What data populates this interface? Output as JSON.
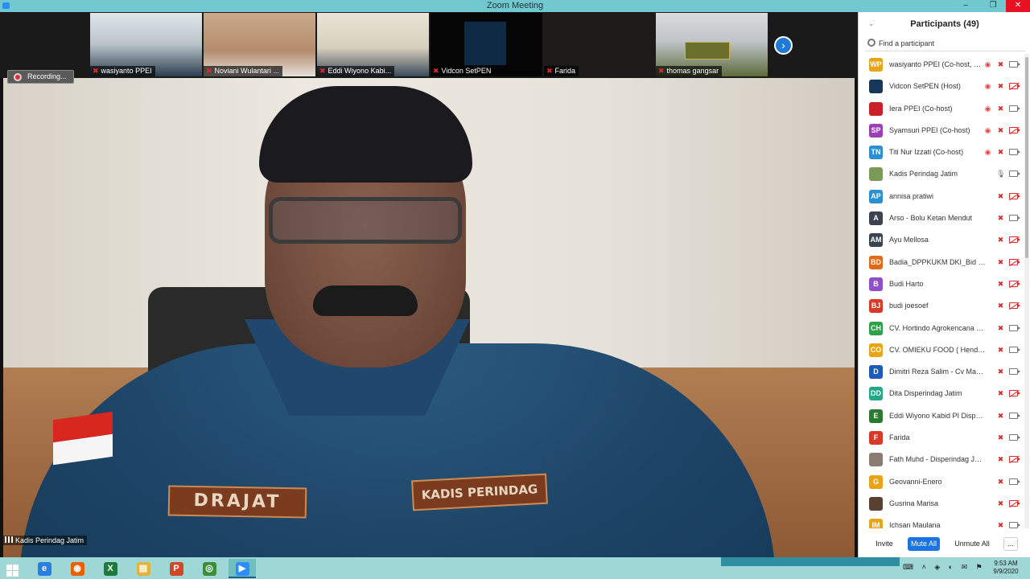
{
  "window": {
    "title": "Zoom Meeting",
    "minimize_glyph": "–",
    "maximize_glyph": "❐",
    "close_glyph": "✕"
  },
  "gallery": {
    "thumbnails": [
      {
        "name": "wasiyanto PPEI",
        "muted": true
      },
      {
        "name": "Noviani Wulantari ...",
        "muted": true
      },
      {
        "name": "Eddi Wiyono Kabi...",
        "muted": true
      },
      {
        "name": "Vidcon SetPEN",
        "muted": true
      },
      {
        "name": "Farida",
        "muted": true
      },
      {
        "name": "thomas gangsar",
        "muted": true
      }
    ],
    "next_glyph": "›"
  },
  "recording": {
    "label": "Recording..."
  },
  "active_speaker": {
    "label": "Kadis Perindag Jatim",
    "name_tag": "DRAJAT",
    "role_tag": "KADIS PERINDAG"
  },
  "participants_panel": {
    "title": "Participants (49)",
    "search_placeholder": "Find a participant",
    "participants": [
      {
        "initials": "WP",
        "name": "wasiyanto PPEI (Co-host, me)",
        "color": "#e8a317",
        "share": true,
        "mic_on": false,
        "cam_on": true
      },
      {
        "initials": "",
        "name": "Vidcon SetPEN (Host)",
        "color": "#16365a",
        "share": true,
        "mic_on": false,
        "cam_on": false
      },
      {
        "initials": "",
        "name": "Iera PPEI (Co-host)",
        "color": "#c9202a",
        "share": true,
        "mic_on": false,
        "cam_on": true
      },
      {
        "initials": "SP",
        "name": "Syamsuri PPEI (Co-host)",
        "color": "#9b3fb5",
        "share": true,
        "mic_on": false,
        "cam_on": false
      },
      {
        "initials": "TN",
        "name": "Titi Nur Izzati (Co-host)",
        "color": "#2b8fd0",
        "share": true,
        "mic_on": false,
        "cam_on": true
      },
      {
        "initials": "",
        "name": "Kadis Perindag Jatim",
        "color": "#7a9a5a",
        "share": false,
        "mic_on": true,
        "cam_on": true
      },
      {
        "initials": "AP",
        "name": "annisa pratiwi",
        "color": "#2b8fd0",
        "share": false,
        "mic_on": false,
        "cam_on": false
      },
      {
        "initials": "A",
        "name": "Arso - Bolu Ketan Mendut",
        "color": "#3a4350",
        "share": false,
        "mic_on": false,
        "cam_on": true
      },
      {
        "initials": "AM",
        "name": "Ayu Mellosa",
        "color": "#3a4350",
        "share": false,
        "mic_on": false,
        "cam_on": false
      },
      {
        "initials": "BD",
        "name": "Badia_DPPKUKM DKI_Bid Dag",
        "color": "#e06a18",
        "share": false,
        "mic_on": false,
        "cam_on": false
      },
      {
        "initials": "B",
        "name": "Budi Harto",
        "color": "#8e4fc9",
        "share": false,
        "mic_on": false,
        "cam_on": false
      },
      {
        "initials": "BJ",
        "name": "budi joesoef",
        "color": "#d83a2a",
        "share": false,
        "mic_on": false,
        "cam_on": false
      },
      {
        "initials": "CH",
        "name": "CV. Hortindo Agrokencana Food",
        "color": "#2fa04a",
        "share": false,
        "mic_on": false,
        "cam_on": true
      },
      {
        "initials": "CO",
        "name": "CV. OMIEKU FOOD ( Hendri Ca...",
        "color": "#e8a317",
        "share": false,
        "mic_on": false,
        "cam_on": true
      },
      {
        "initials": "D",
        "name": "Dimitri Reza Salim - Cv Manna I...",
        "color": "#1e5bb8",
        "share": false,
        "mic_on": false,
        "cam_on": true
      },
      {
        "initials": "DD",
        "name": "Dita Disperindag Jatim",
        "color": "#24a889",
        "share": false,
        "mic_on": false,
        "cam_on": false
      },
      {
        "initials": "E",
        "name": "Eddi Wiyono Kabid PI Disperind...",
        "color": "#2c7a32",
        "share": false,
        "mic_on": false,
        "cam_on": true
      },
      {
        "initials": "F",
        "name": "Farida",
        "color": "#d83a2a",
        "share": false,
        "mic_on": false,
        "cam_on": true
      },
      {
        "initials": "",
        "name": "Fath Muhd - Disperindag Jatim",
        "color": "#8a7c70",
        "share": false,
        "mic_on": false,
        "cam_on": false
      },
      {
        "initials": "G",
        "name": "Geovanni-Enero",
        "color": "#e8a317",
        "share": false,
        "mic_on": false,
        "cam_on": true
      },
      {
        "initials": "",
        "name": "Gusrina Marisa",
        "color": "#5a4030",
        "share": false,
        "mic_on": false,
        "cam_on": false
      },
      {
        "initials": "IM",
        "name": "Ichsan Maulana",
        "color": "#e8a317",
        "share": false,
        "mic_on": false,
        "cam_on": true
      }
    ],
    "footer": {
      "invite": "Invite",
      "mute_all": "Mute All",
      "unmute_all": "Unmute All",
      "more": "..."
    }
  },
  "taskbar": {
    "apps": [
      {
        "name": "internet-explorer",
        "glyph": "e",
        "color": "#2a7de1"
      },
      {
        "name": "firefox",
        "glyph": "◉",
        "color": "#e66000"
      },
      {
        "name": "excel",
        "glyph": "X",
        "color": "#1d7a3a"
      },
      {
        "name": "file-explorer",
        "glyph": "▤",
        "color": "#e5b33a"
      },
      {
        "name": "powerpoint",
        "glyph": "P",
        "color": "#d24726"
      },
      {
        "name": "chrome",
        "glyph": "◎",
        "color": "#3b8f3b"
      },
      {
        "name": "zoom",
        "glyph": "▶",
        "color": "#2d8cff"
      }
    ],
    "time": "9:53 AM",
    "date": "9/9/2020"
  }
}
